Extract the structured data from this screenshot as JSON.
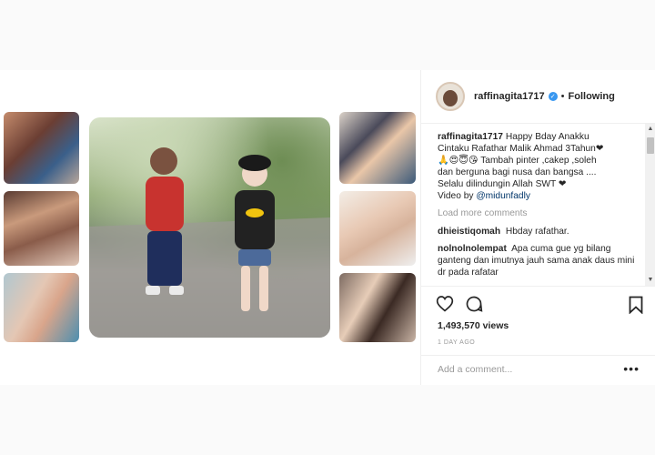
{
  "post": {
    "username": "raffinagita1717",
    "dot": "•",
    "follow_label": "Following",
    "caption_username": "raffinagita1717",
    "caption_lines": [
      "Happy Bday Anakku",
      "Cintaku Rafathar Malik Ahmad 3Tahun❤",
      "🙏😍😇😘 Tambah pinter ,cakep ,soleh",
      "dan berguna bagi nusa dan bangsa ....",
      "Selalu dilindungin Allah SWT ❤"
    ],
    "video_by_label": "Video by",
    "video_by_mention": "@midunfadly",
    "load_more": "Load more comments",
    "comments": [
      {
        "username": "dhieistiqomah",
        "text": "Hbday rafathar."
      },
      {
        "username": "nolnolnolempat",
        "text": "Apa cuma gue yg bilang ganteng dan imutnya jauh sama anak daus mini dr pada rafatar"
      }
    ],
    "views": "1,493,570 views",
    "date": "1 DAY AGO",
    "add_comment_placeholder": "Add a comment...",
    "more_options": "•••"
  },
  "icons": {
    "like": "heart-icon",
    "comment": "comment-bubble-icon",
    "save": "bookmark-icon",
    "verified": "verified-badge-icon"
  },
  "colors": {
    "verified_blue": "#3897f0",
    "heart_red": "#ed4956",
    "mention": "#003569"
  }
}
